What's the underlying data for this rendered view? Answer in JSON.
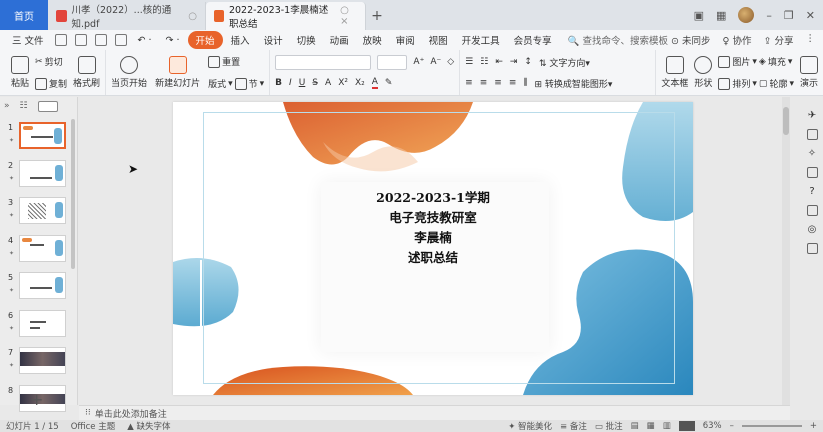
{
  "tabs": {
    "home": "首页",
    "doc1": "川孝（2022）...核的通知.pdf",
    "active": "2022-2023-1李晨楠述职总结"
  },
  "menu": {
    "file": "三 文件",
    "items": [
      "开始",
      "插入",
      "设计",
      "切换",
      "动画",
      "放映",
      "审阅",
      "视图",
      "开发工具",
      "会员专享"
    ],
    "search": "查找命令、搜索模板",
    "sync": "未同步",
    "collab": "协作",
    "share": "分享"
  },
  "ribbon": {
    "paste": "粘贴",
    "cut": "剪切",
    "copy": "复制",
    "format_painter": "格式刷",
    "play_from": "当页开始",
    "new_slide": "新建幻灯片",
    "layout": "版式",
    "section": "节",
    "reset": "重置",
    "text_box": "文本框",
    "shape": "形状",
    "arrange": "排列",
    "outline": "轮廓",
    "slide_show": "演示",
    "text_direction": "文字方向",
    "convert_smartart": "转换成智能图形",
    "picture": "图片",
    "fill": "填充"
  },
  "slides": {
    "numbers": [
      "1",
      "2",
      "3",
      "4",
      "5",
      "6",
      "7",
      "8"
    ]
  },
  "slide": {
    "title_lines": [
      "2022-2023-1学期",
      "电子竞技教研室",
      "李晨楠",
      "述职总结"
    ]
  },
  "notes_placeholder": "单击此处添加备注",
  "status": {
    "slide_count": "幻灯片 1 / 15",
    "theme": "Office 主题",
    "missing_font": "缺失字体",
    "beautify": "智能美化",
    "remarks": "备注",
    "comments": "批注",
    "zoom": "63%"
  },
  "colors": {
    "accent_orange": "#e8632b",
    "wps_blue": "#2d6fd6",
    "slide_blue": "#3f9cc9"
  }
}
